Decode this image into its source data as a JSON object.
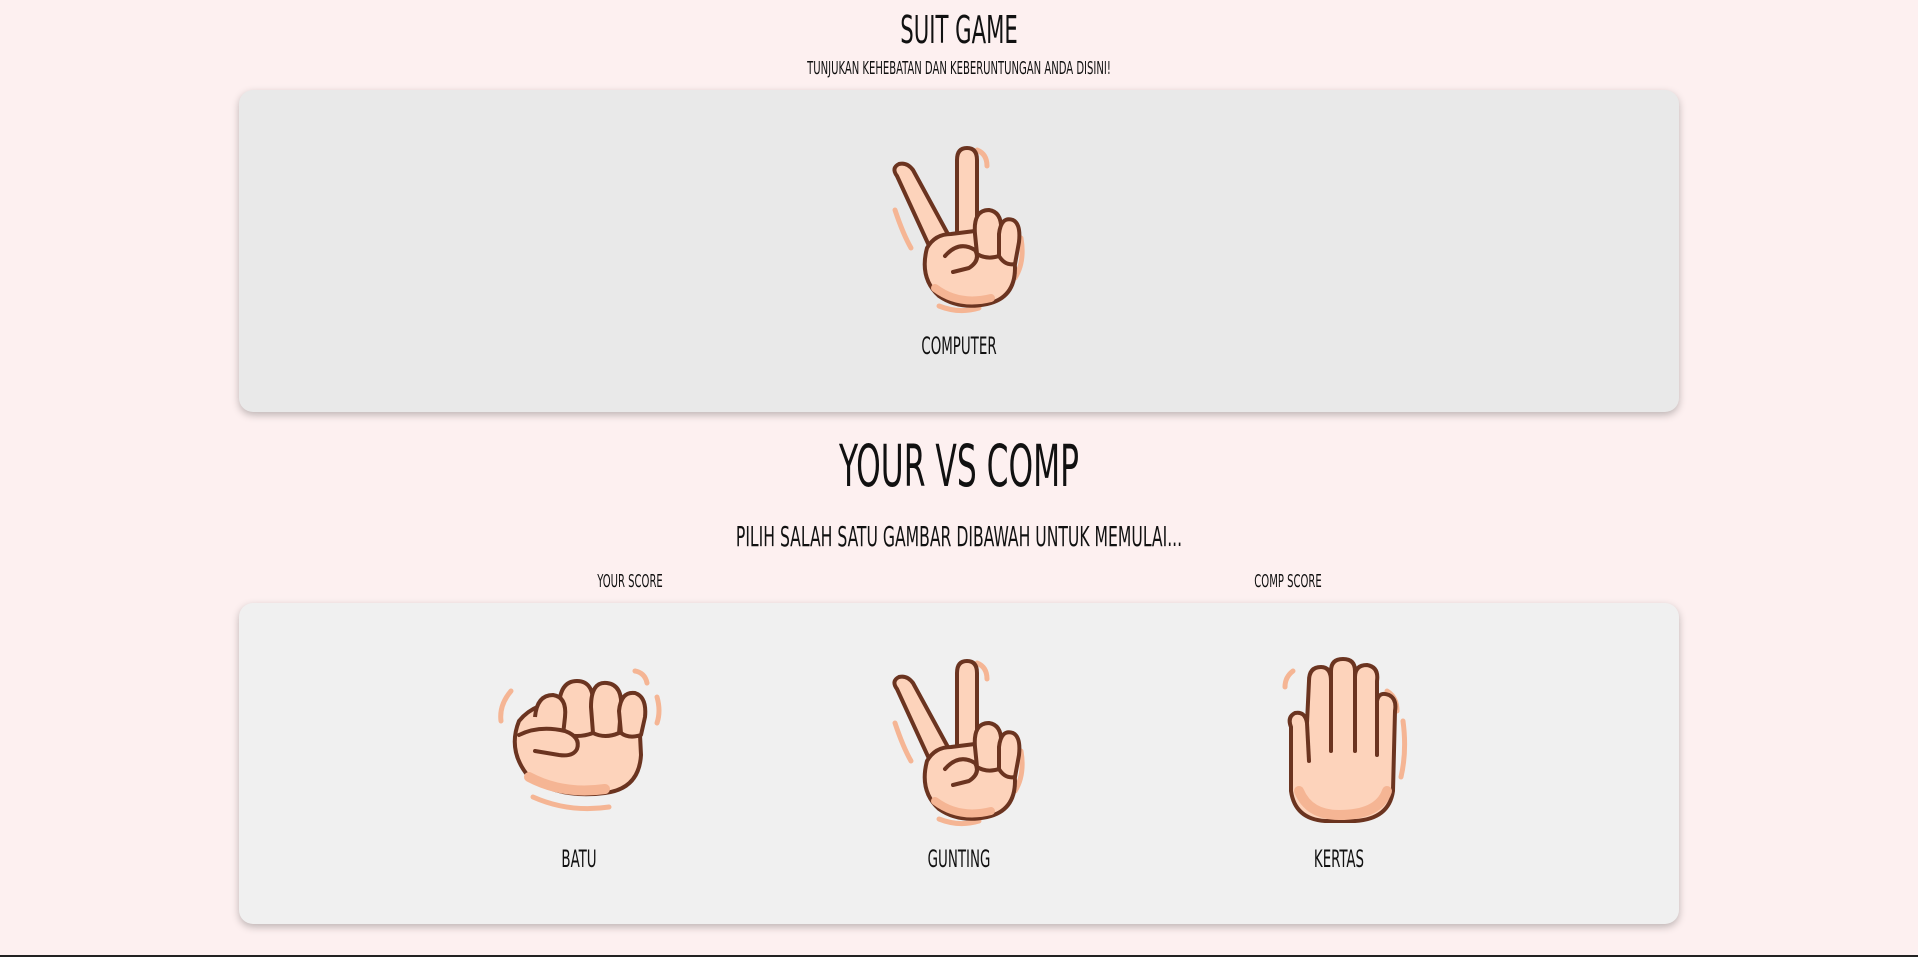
{
  "header": {
    "title": "Suit Game",
    "subtitle": "Tunjukan kehebatan dan keberuntungan anda disini!"
  },
  "computer": {
    "label": "Computer",
    "hand_icon": "scissors-hand-icon"
  },
  "versus": {
    "title": "Your vs Comp",
    "instruction": "Pilih salah satu gambar dibawah untuk memulai..."
  },
  "scores": {
    "your_label": "Your Score",
    "comp_label": "Comp Score"
  },
  "choices": [
    {
      "label": "Batu",
      "icon": "rock-fist-icon"
    },
    {
      "label": "Gunting",
      "icon": "scissors-hand-icon"
    },
    {
      "label": "Kertas",
      "icon": "paper-hand-icon"
    }
  ],
  "colors": {
    "background": "#fdf0f0",
    "skin": "#fdd3bb",
    "skin_shadow": "#f5b594",
    "outline": "#6b3420"
  }
}
